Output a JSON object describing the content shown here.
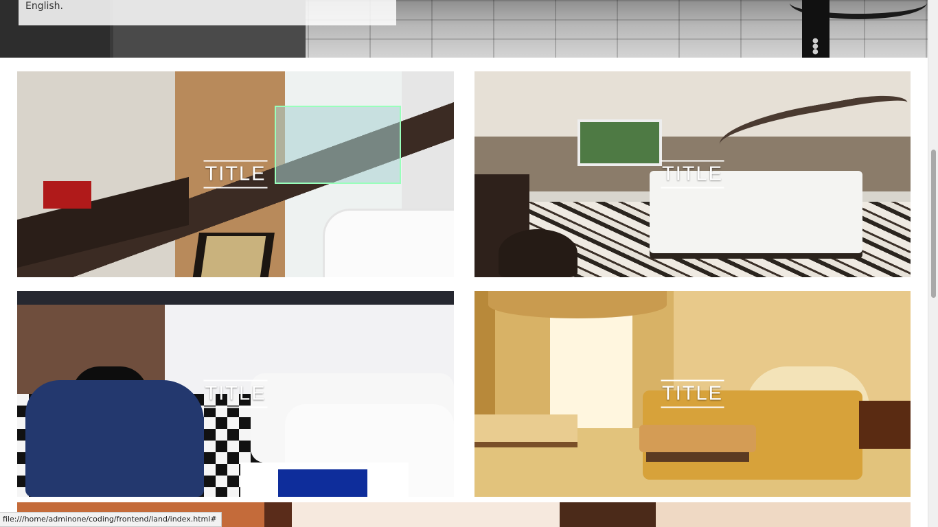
{
  "hero": {
    "card_text": "English."
  },
  "gallery": {
    "tiles": [
      {
        "title": "TITLE"
      },
      {
        "title": "TITLE"
      },
      {
        "title": "TITLE"
      },
      {
        "title": "TITLE"
      }
    ]
  },
  "browser": {
    "status_url": "file:///home/adminone/coding/frontend/land/index.html#"
  }
}
